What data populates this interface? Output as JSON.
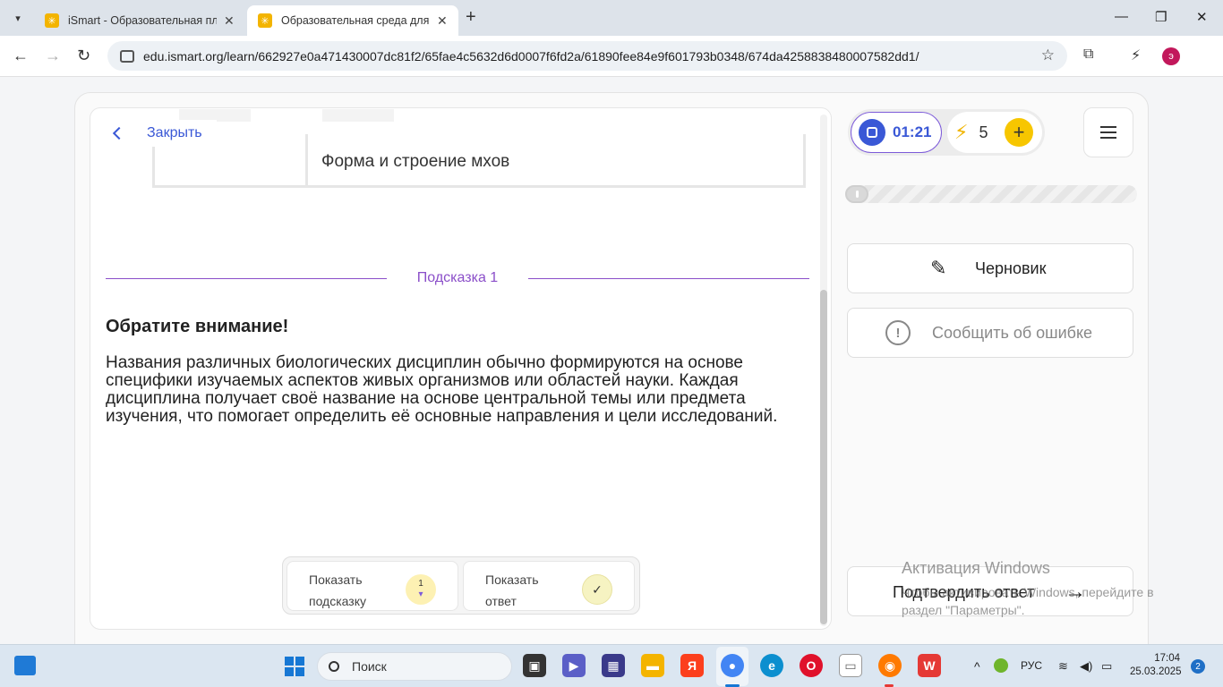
{
  "browser": {
    "tabs": [
      {
        "title": "iSmart - Образовательная пла"
      },
      {
        "title": "Образовательная среда для са"
      }
    ],
    "url": "edu.ismart.org/learn/662927e0a471430007dc81f2/65fae4c5632d6d0007f6fd2a/61890fee84e9f601793b0348/674da4258838480007582dd1/",
    "profile_letter": "э"
  },
  "lesson": {
    "close_label": "Закрыть",
    "table_cell_text": "Форма и строение мхов",
    "hint_title": "Подсказка  1",
    "attention": "Обратите внимание!",
    "hint_text": "Названия различных биологических дисциплин обычно формируются на основе специфики изучаемых аспектов живых организмов или областей науки. Каждая дисциплина получает своё название на основе центральной темы или предмета изучения, что помогает определить её основные направления и цели исследований.",
    "show_hint_label": "Показать подсказку",
    "hint_badge_count": "1",
    "show_answer_label": "Показать ответ"
  },
  "sidebar": {
    "timer": "01:21",
    "energy_count": "5",
    "progress_fraction": 0.0,
    "draft_label": "Черновик",
    "report_label": "Сообщить об ошибке",
    "confirm_label": "Подтвердить ответ"
  },
  "watermark": {
    "title": "Активация Windows",
    "subtitle": "Чтобы активировать Windows, перейдите в раздел \"Параметры\"."
  },
  "taskbar": {
    "search_placeholder": "Поиск",
    "language": "РУС",
    "time": "17:04",
    "date": "25.03.2025",
    "notifications": "2"
  },
  "colors": {
    "accent_blue": "#3a58d6",
    "hint_purple": "#8b4fc9",
    "energy_yellow": "#f7c600"
  }
}
